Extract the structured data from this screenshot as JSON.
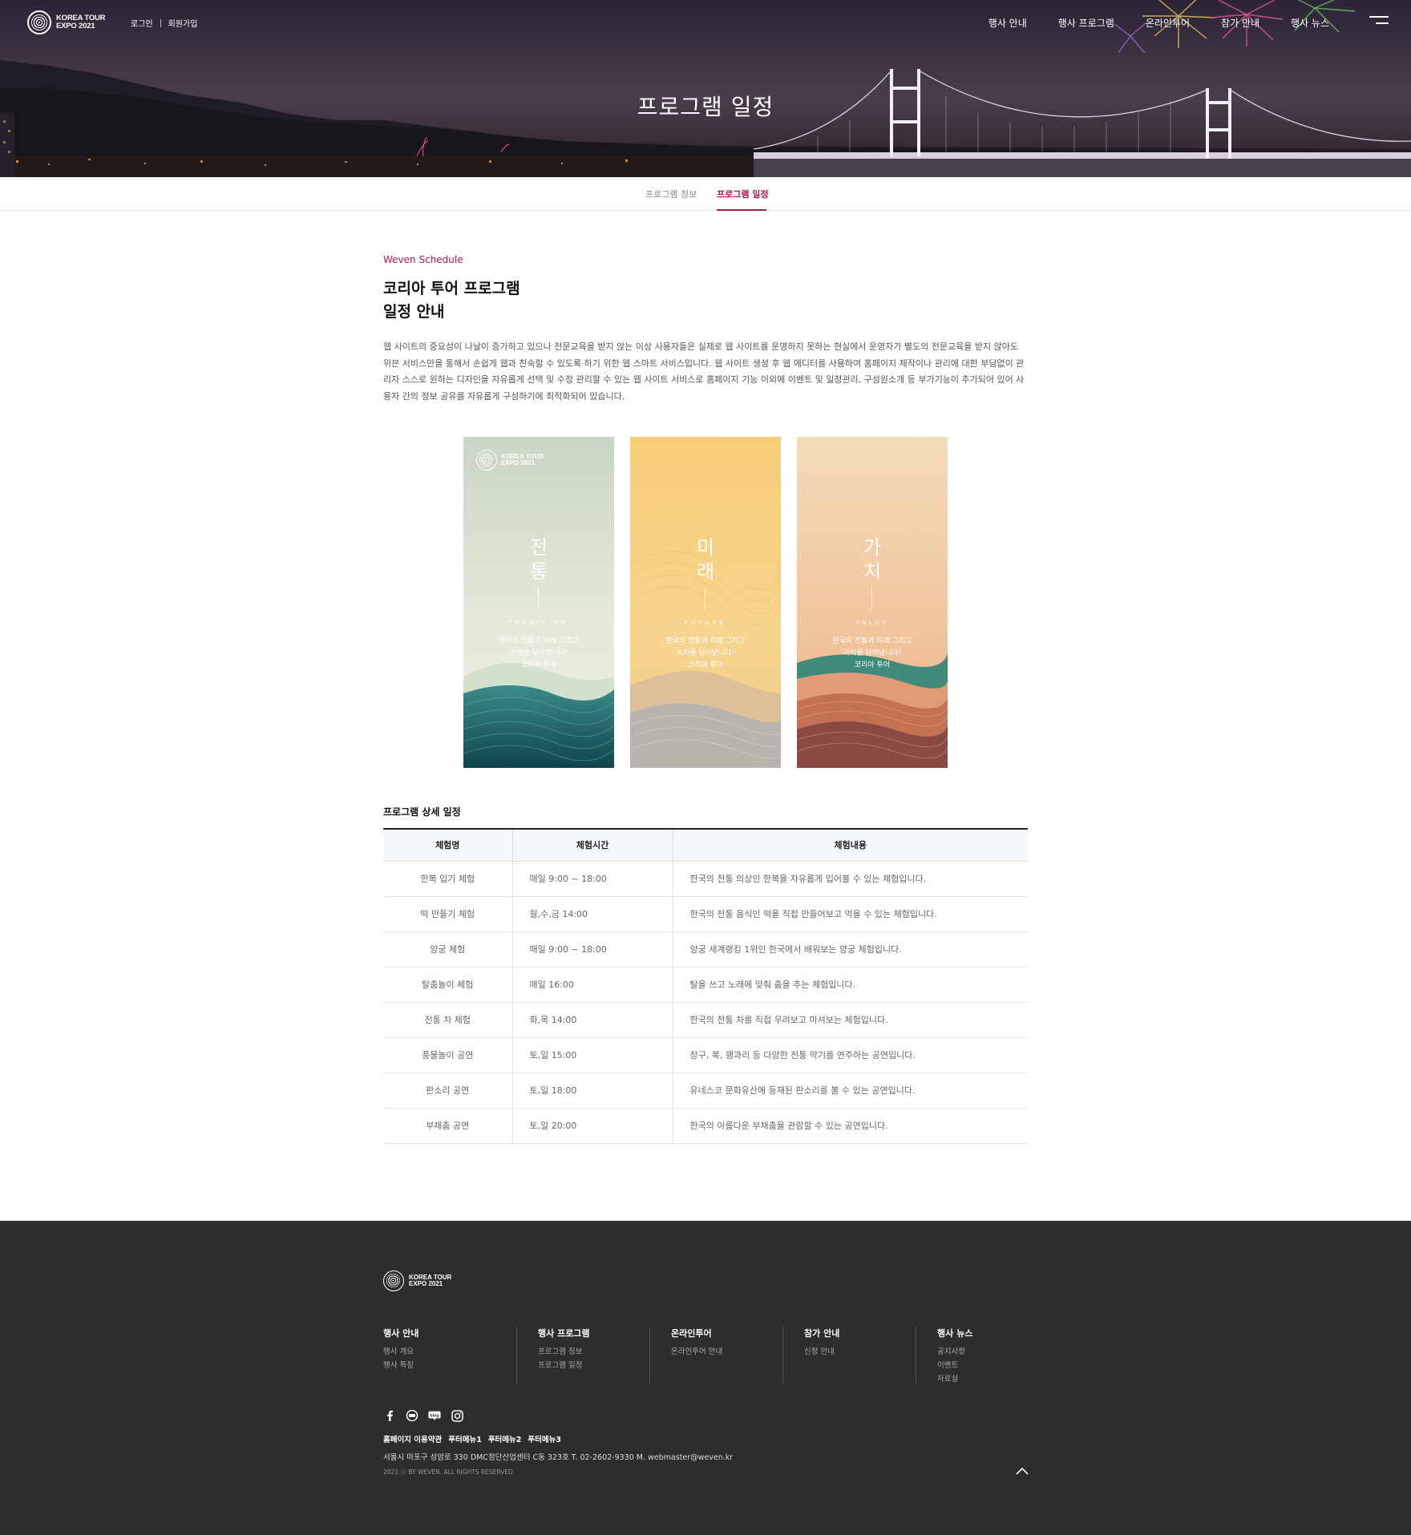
{
  "header": {
    "logo_line1": "KOREA TOUR",
    "logo_line2": "EXPO 2021",
    "login": "로그인",
    "signup": "회원가입",
    "nav": [
      "행사 안내",
      "행사 프로그램",
      "온라인투어",
      "참가 안내",
      "행사 뉴스"
    ],
    "menu_icon": "hamburger-icon",
    "page_title": "프로그램 일정"
  },
  "subtabs": {
    "items": [
      "프로그램 정보",
      "프로그램 일정"
    ],
    "active": "프로그램 일정"
  },
  "intro": {
    "eyebrow": "Weven Schedule",
    "title_line1": "코리아 투어 프로그램",
    "title_line2": "일정 안내",
    "description": "웹 사이트의 중요성이 나날이 증가하고 있으나 전문교육을 받지 않는 이상 사용자들은 실제로 웹 사이트를 운영하지 못하는 현실에서 운영자가 별도의 전문교육을 받지 않아도 위븐 서비스만을 통해서 손쉽게 웹과 친숙할 수 있도록 하기 위한 웹 스마트 서비스입니다. 웹 사이트 생성 후 웹 에디터를 사용하여 홈페이지 제작이나 관리에 대한 부담없이 관리자 스스로 원하는 디자인을 자유롭게 선택 및 수정 관리할 수 있는 웹 사이트 서비스로 홈페이지 기능 이외에 이벤트 및 일정관리, 구성원소개 등 부가기능이 추가되어 있어 사용자 간의 정보 공유를 자유롭게 구성하기에 최적화되어 있습니다."
  },
  "banners": [
    {
      "char1": "전",
      "char2": "통",
      "english": "TRADITION",
      "copy1": "한국의 전통과 미래 그리고",
      "copy2": "가치를 담아냅니다!",
      "copy3": "코리아 투어",
      "has_logo": true,
      "logo_line1": "KOREA TOUR",
      "logo_line2": "EXPO 2021"
    },
    {
      "char1": "미",
      "char2": "래",
      "english": "FUTURE",
      "copy1": "한국의 전통과 미래 그리고",
      "copy2": "가치를 담아냅니다!",
      "copy3": "코리아 투어",
      "has_logo": false
    },
    {
      "char1": "가",
      "char2": "치",
      "english": "VALUE",
      "copy1": "한국의 전통과 미래 그리고",
      "copy2": "가치를 담아냅니다!",
      "copy3": "코리아 투어",
      "has_logo": false
    }
  ],
  "schedule": {
    "title": "프로그램 상세 일정",
    "columns": [
      "체험명",
      "체험시간",
      "체험내용"
    ],
    "rows": [
      {
        "name": "한복 입기 체험",
        "time": "매일   9:00  ~  18:00",
        "desc": "한국의 전통 의상인 한복을 자유롭게 입어볼 수 있는 체험입니다."
      },
      {
        "name": "떡 만들기 체험",
        "time": "월,수,금  14:00",
        "desc": "한국의 전통 음식인 떡을 직접 만들어보고 먹을 수 있는 체험입니다."
      },
      {
        "name": "양궁 체험",
        "time": "매일   9:00  ~  18:00",
        "desc": "양궁 세계랭킹 1위인 한국에서 배워보는 양궁 체험입니다."
      },
      {
        "name": "탈춤놀이 체험",
        "time": "매일  16:00",
        "desc": "탈을 쓰고 노래에 맞춰 춤을 추는 체험입니다."
      },
      {
        "name": "전통 차 체험",
        "time": "화,목  14:00",
        "desc": "한국의 전통 차를 직접 우려보고 마셔보는 체험입니다."
      },
      {
        "name": "풍물놀이 공연",
        "time": "토,일  15:00",
        "desc": "장구, 북, 꽹과리 등 다양한 전통 악기를 연주하는 공연입니다."
      },
      {
        "name": "판소리 공연",
        "time": "토,일  18:00",
        "desc": "유네스코 문화유산에 등재된 판소리를 볼 수 있는 공연입니다."
      },
      {
        "name": "부채춤 공연",
        "time": "토,일  20:00",
        "desc": "한국의 아름다운 부채춤을 관람할 수 있는 공연입니다."
      }
    ]
  },
  "footer": {
    "logo_line1": "KOREA TOUR",
    "logo_line2": "EXPO 2021",
    "columns": [
      {
        "title": "행사 안내",
        "links": [
          "행사 개요",
          "행사 특징"
        ]
      },
      {
        "title": "행사 프로그램",
        "links": [
          "프로그램 정보",
          "프로그램 일정"
        ]
      },
      {
        "title": "온라인투어",
        "links": [
          "온라인투어 안내"
        ]
      },
      {
        "title": "참가 안내",
        "links": [
          "신청 안내"
        ]
      },
      {
        "title": "행사 뉴스",
        "links": [
          "공지사항",
          "이벤트",
          "자료실"
        ]
      }
    ],
    "social": [
      "facebook-icon",
      "youtube-icon",
      "blog-icon",
      "instagram-icon"
    ],
    "links": [
      "홈페이지 이용약관",
      "푸터메뉴1",
      "푸터메뉴2",
      "푸터메뉴3"
    ],
    "address": "서울시 마포구 성암로 330 DMC첨단산업센터 C동 323호   T. 02-2602-9330 M. webmaster@weven.kr",
    "copyright": "2021 ⓒ BY WEVEN. ALL RIGHTS RESERVED",
    "top_icon": "chevron-up-icon"
  },
  "colors": {
    "accent": "#a31d4f",
    "footer_bg": "#2d2d2d",
    "table_head_bg": "#f4f8fa"
  }
}
